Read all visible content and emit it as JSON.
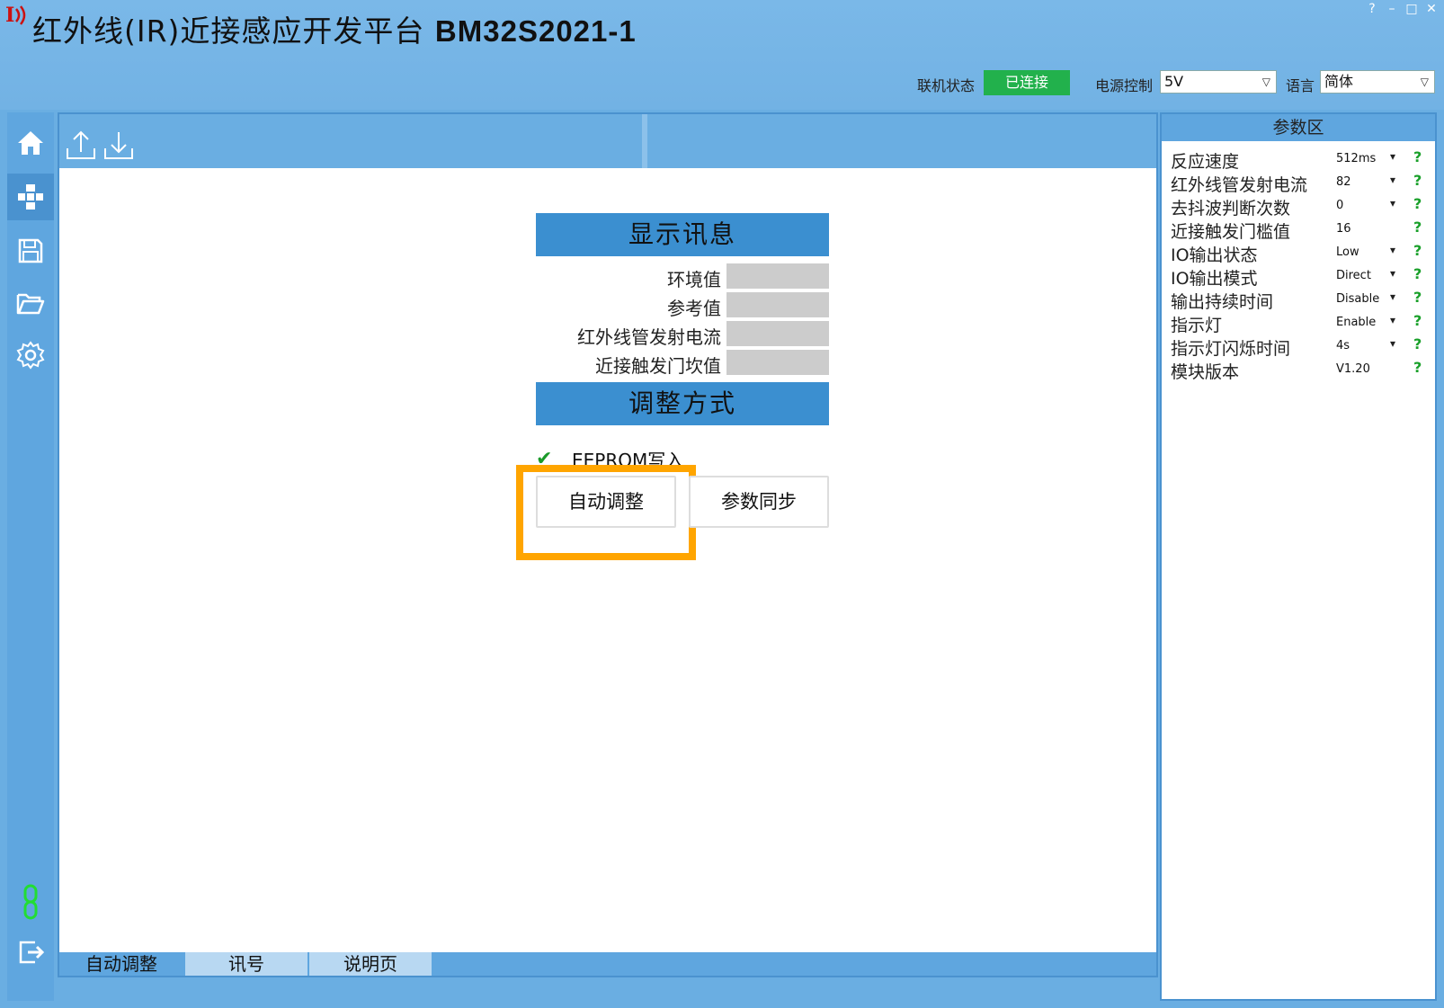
{
  "window": {
    "title_cn": "红外线(IR)近接感应开发平台",
    "title_model": "BM32S2021-1",
    "controls": [
      "?",
      "–",
      "□",
      "✕"
    ]
  },
  "status": {
    "connection_label": "联机状态",
    "connection_value": "已连接",
    "power_label": "电源控制",
    "power_value": "5V",
    "language_label": "语言",
    "language_value": "简体"
  },
  "sidebar": {
    "items": [
      {
        "icon": "home-icon"
      },
      {
        "icon": "module-icon"
      },
      {
        "icon": "save-icon"
      },
      {
        "icon": "folder-open-icon"
      },
      {
        "icon": "gear-icon"
      },
      {
        "icon": "link-icon"
      },
      {
        "icon": "exit-icon"
      }
    ]
  },
  "display_section": {
    "header": "显示讯息",
    "rows": [
      {
        "label": "环境值",
        "value": ""
      },
      {
        "label": "参考值",
        "value": ""
      },
      {
        "label": "红外线管发射电流",
        "value": ""
      },
      {
        "label": "近接触发门坎值",
        "value": ""
      }
    ]
  },
  "adjust_section": {
    "header": "调整方式",
    "eeprom_label": "EEPROM写入",
    "eeprom_checked": "✔",
    "auto_button": "自动调整",
    "sync_button": "参数同步"
  },
  "bottom_tabs": [
    "自动调整",
    "讯号",
    "说明页"
  ],
  "params": {
    "header": "参数区",
    "rows": [
      {
        "name": "反应速度",
        "value": "512ms",
        "dropdown": true
      },
      {
        "name": "红外线管发射电流",
        "value": "82",
        "dropdown": true
      },
      {
        "name": "去抖波判断次数",
        "value": "0",
        "dropdown": true
      },
      {
        "name": "近接触发门槛值",
        "value": "16",
        "dropdown": false
      },
      {
        "name": "IO输出状态",
        "value": "Low",
        "dropdown": true
      },
      {
        "name": "IO输出模式",
        "value": "Direct",
        "dropdown": true
      },
      {
        "name": "输出持续时间",
        "value": "Disable",
        "dropdown": true
      },
      {
        "name": "指示灯",
        "value": "Enable",
        "dropdown": true
      },
      {
        "name": "指示灯闪烁时间",
        "value": "4s",
        "dropdown": true
      },
      {
        "name": "模块版本",
        "value": "V1.20",
        "dropdown": false
      }
    ],
    "help_glyph": "?"
  },
  "colors": {
    "accent": "#3b8fd0",
    "connected": "#22b14c",
    "highlight": "#ffa500"
  }
}
